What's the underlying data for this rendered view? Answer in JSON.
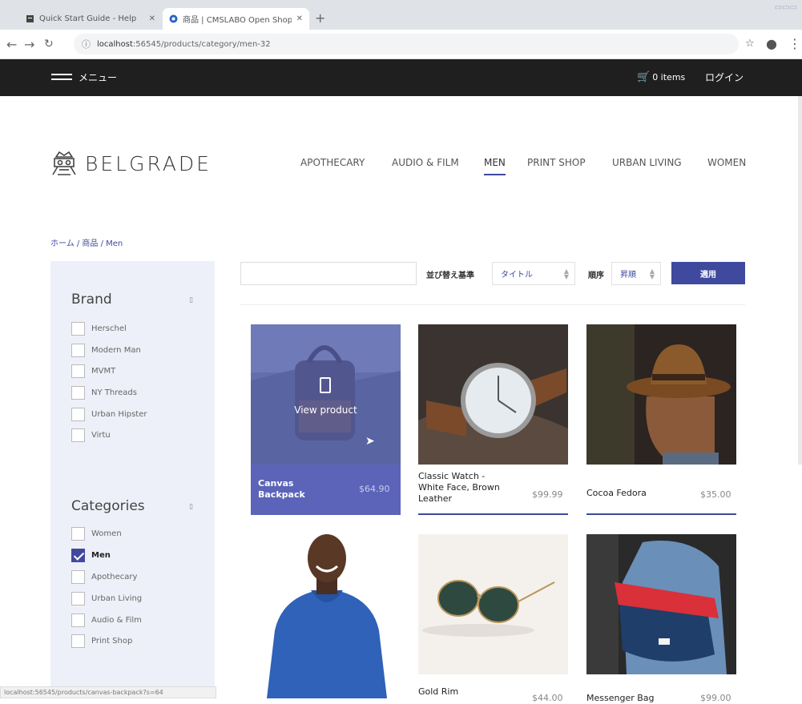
{
  "browser": {
    "tabs": [
      {
        "title": "Quick Start Guide - Help",
        "active": false
      },
      {
        "title": "商品 | CMSLABO Open Shop",
        "active": true
      }
    ],
    "url_host": "localhost",
    "url_path": ":56545/products/category/men-32",
    "status_url": "localhost:56545/products/canvas-backpack?s=64"
  },
  "header": {
    "menu_label": "メニュー",
    "cart_label": "0 items",
    "login_label": "ログイン"
  },
  "logo": {
    "text": "BELGRADE"
  },
  "nav": {
    "items": [
      "APOTHECARY",
      "AUDIO & FILM",
      "MEN",
      "PRINT SHOP",
      "URBAN LIVING",
      "WOMEN"
    ],
    "active": "MEN"
  },
  "breadcrumb": "ホーム / 商品 / Men",
  "sidebar": {
    "brand": {
      "title": "Brand",
      "items": [
        "Herschel",
        "Modern Man",
        "MVMT",
        "NY Threads",
        "Urban Hipster",
        "Virtu"
      ]
    },
    "categories": {
      "title": "Categories",
      "items": [
        "Women",
        "Men",
        "Apothecary",
        "Urban Living",
        "Audio & Film",
        "Print Shop"
      ],
      "checked": "Men"
    }
  },
  "sort": {
    "sort_by_label": "並び替え基準",
    "sort_by_value": "タイトル",
    "order_label": "順序",
    "order_value": "昇順",
    "apply_label": "適用"
  },
  "products": [
    {
      "name": "Canvas Backpack",
      "price": "$64.90",
      "hover_label": "View product"
    },
    {
      "name": "Classic Watch - White Face, Brown Leather",
      "price": "$99.99"
    },
    {
      "name": "Cocoa Fedora",
      "price": "$35.00"
    },
    {
      "name": "",
      "price": ""
    },
    {
      "name": "Gold Rim",
      "price": "$44.00"
    },
    {
      "name": "Messenger Bag",
      "price": "$99.00"
    }
  ],
  "colors": {
    "accent": "#3f4a9e",
    "header": "#1f1f1f",
    "sidebar": "#eef0f9"
  }
}
